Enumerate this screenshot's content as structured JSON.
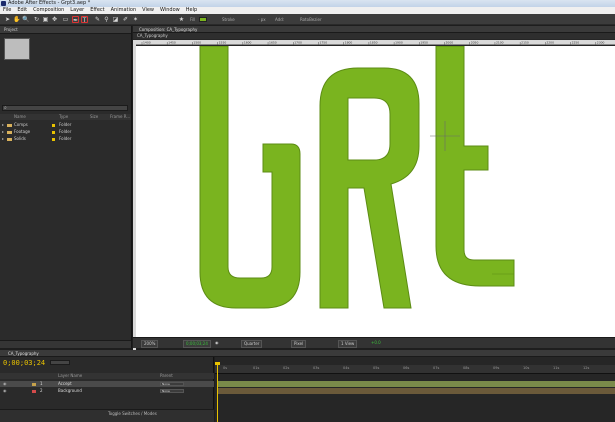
{
  "window": {
    "title": "Adobe After Effects - Grpt3.aep *"
  },
  "menu": [
    "File",
    "Edit",
    "Composition",
    "Layer",
    "Effect",
    "Animation",
    "View",
    "Window",
    "Help"
  ],
  "toolbar": {
    "fill_label": "Fill",
    "stroke_label": "Stroke",
    "stroke_width": "- px",
    "add_label": "Add:",
    "roto_label": "RotoBezier",
    "fill_color": "#7ab41f"
  },
  "project": {
    "tab": "Project",
    "columns": {
      "name": "Name",
      "type": "Type",
      "size": "Size",
      "frame": "Frame R..."
    },
    "items": [
      {
        "name": "Comps",
        "type": "Folder"
      },
      {
        "name": "Footage",
        "type": "Folder"
      },
      {
        "name": "Solids",
        "type": "Folder"
      }
    ]
  },
  "composition": {
    "tab": "Composition: CA_Typography",
    "sub_tab": "CA_Typography",
    "zoom": "200%",
    "timecode": "0;00;03;24",
    "resolution": "Quarter",
    "camera": "Pixel",
    "view": "1 View",
    "exposure": "+0.0",
    "shape_color": "#7ab41f",
    "ruler_ticks": [
      "1400",
      "1450",
      "1500",
      "1550",
      "1600",
      "1650",
      "1700",
      "1750",
      "1800",
      "1850",
      "1900",
      "1950",
      "2000",
      "2050",
      "2100",
      "2150",
      "2200",
      "2250",
      "2300"
    ]
  },
  "timeline": {
    "tab": "CA_Typography",
    "timecode": "0;00;03;24",
    "columns": {
      "layer": "Layer Name",
      "parent": "Parent"
    },
    "layers": [
      {
        "num": "1",
        "name": "Accept",
        "mode": "None",
        "label_color": "#c6a24b",
        "bar_color": "#7a8a4a"
      },
      {
        "num": "2",
        "name": "Background",
        "mode": "None",
        "label_color": "#d34b4b",
        "bar_color": "#6b5a3a"
      }
    ],
    "ruler": [
      "0s",
      "01s",
      "02s",
      "03s",
      "04s",
      "05s",
      "06s",
      "07s",
      "08s",
      "09s",
      "10s",
      "11s",
      "12s"
    ],
    "toggle_label": "Toggle Switches / Modes"
  }
}
